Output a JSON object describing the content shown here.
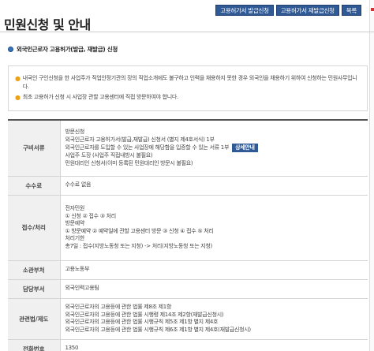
{
  "title": "민원신청 및 안내",
  "buttons": {
    "issue": "고용허가서 발급신청",
    "reissue": "고용허가서 재발급신청",
    "list": "목록"
  },
  "section": {
    "label": "외국인근로자 고용허가(발급, 재발급) 신청"
  },
  "notice": [
    "내국인 구인신청을 한 사업주가 직업안정기관의 장의 직업소개에도 불구하고 인력을 채용하지 못한 경우 외국인을 채용하기 위하여 신청하는 민원사무입니다.",
    "최초 고용허가 신청 시 사업장 관할 고용센터에 직접 방문하여야 합니다."
  ],
  "rows": {
    "docs": {
      "label": "구비서류",
      "lines": [
        "방문신청",
        "외국인근로자 고용허가서(발급,재발급) 신청서 (별지 제4호서식) 1부",
        "외국인근로자를 도입할 수 있는 사업장에 해당함을 입증할 수 있는 서류 1부",
        "사업주 도장 (사업주 직접내방시 불필요)",
        "민원대리인 신청서(이미 등록된 민원대리인 방문시 불필요)"
      ],
      "detail_button": "상세안내"
    },
    "fee": {
      "label": "수수료",
      "value": "수수료 없음"
    },
    "process": {
      "label": "접수/처리",
      "lines": [
        "전자민원",
        "① 신청 ② 접수 ③ 처리",
        "방문예약",
        "① 방문예약 ② 예약일에 관할 고용센터 방문 ③ 신청 ④ 접수 ⑤ 처리",
        "처리기한",
        "총7일 : 접수(지방노동청 또는 지청) -> 처리(지방노동청 또는 지청)"
      ]
    },
    "ministry": {
      "label": "소관부처",
      "value": "고용노동부"
    },
    "dept": {
      "label": "담당부서",
      "value": "외국인력고용팀"
    },
    "laws": {
      "label": "관련법/제도",
      "lines": [
        "외국인근로자의 고용등에 관한 법률 제8조 제1항",
        "외국인근로자의 고용등에 관한 법률 시행령 제14조 제2항(재발급신청시)",
        "외국인근로자의 고용등에 관한 법률 시행규칙 제5조 제1항 별지 제4호",
        "외국인근로자의 고용등에 관한 법률 시행규칙 제6조 제1항 별지 제4호(재발급신청시)"
      ]
    },
    "phone": {
      "label": "전화번호",
      "value": "1350"
    }
  }
}
